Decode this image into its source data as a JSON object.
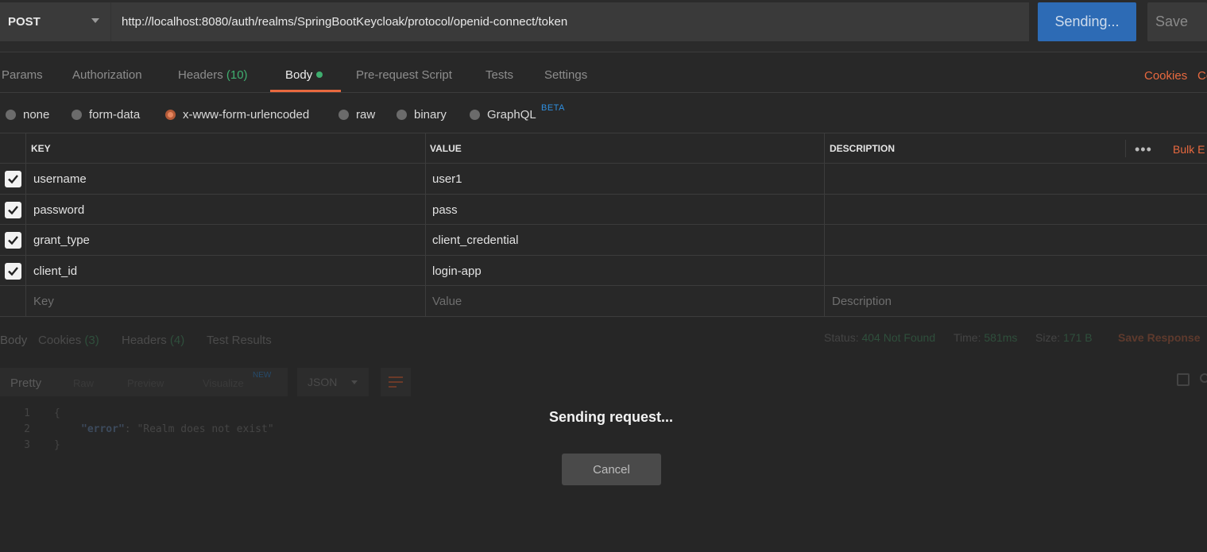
{
  "request": {
    "method": "POST",
    "url": "http://localhost:8080/auth/realms/SpringBootKeycloak/protocol/openid-connect/token",
    "send_label": "Sending...",
    "save_label": "Save"
  },
  "tabs": {
    "params": "Params",
    "authorization": "Authorization",
    "headers": "Headers",
    "headers_count": "(10)",
    "body": "Body",
    "pre_request": "Pre-request Script",
    "tests": "Tests",
    "settings": "Settings",
    "cookies": "Cookies",
    "code": "Co"
  },
  "body_types": {
    "none": "none",
    "form_data": "form-data",
    "urlencoded": "x-www-form-urlencoded",
    "raw": "raw",
    "binary": "binary",
    "graphql": "GraphQL",
    "beta": "BETA",
    "selected": "x-www-form-urlencoded"
  },
  "kv_table": {
    "headers": {
      "key": "KEY",
      "value": "VALUE",
      "description": "DESCRIPTION"
    },
    "bulk_edit": "Bulk E",
    "rows": [
      {
        "key": "username",
        "value": "user1",
        "description": ""
      },
      {
        "key": "password",
        "value": "pass",
        "description": ""
      },
      {
        "key": "grant_type",
        "value": "client_credential",
        "description": ""
      },
      {
        "key": "client_id",
        "value": "login-app",
        "description": ""
      }
    ],
    "placeholders": {
      "key": "Key",
      "value": "Value",
      "description": "Description"
    }
  },
  "response": {
    "tabs": {
      "body": "Body",
      "cookies": "Cookies",
      "cookies_count": "(3)",
      "headers": "Headers",
      "headers_count": "(4)",
      "test_results": "Test Results"
    },
    "status_label": "Status:",
    "status_value": "404 Not Found",
    "time_label": "Time:",
    "time_value": "581ms",
    "size_label": "Size:",
    "size_value": "171 B",
    "save_response": "Save Response",
    "format": {
      "pretty": "Pretty",
      "raw": "Raw",
      "preview": "Preview",
      "visualize": "Visualize",
      "new": "NEW",
      "language": "JSON"
    },
    "code_lines": {
      "n1": "1",
      "n2": "2",
      "n3": "3",
      "l1": "{",
      "key": "\"error\"",
      "colon": ": ",
      "val": "\"Realm does not exist\"",
      "l3": "}"
    }
  },
  "overlay": {
    "message": "Sending request...",
    "cancel": "Cancel"
  }
}
